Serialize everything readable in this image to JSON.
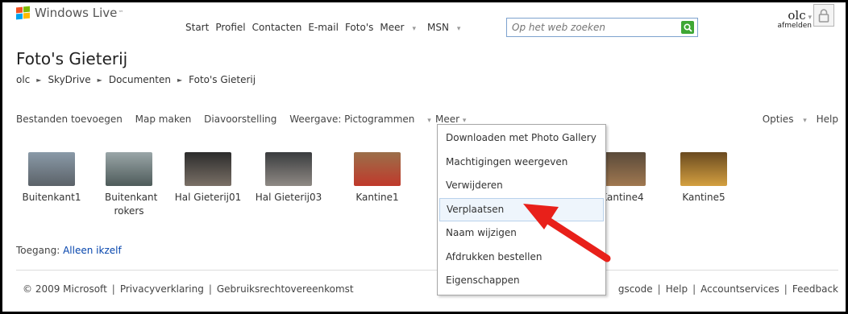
{
  "header": {
    "logo_text": "Windows Live",
    "logo_tm": "™",
    "nav": [
      {
        "label": "Start",
        "dropdown": false
      },
      {
        "label": "Profiel",
        "dropdown": false
      },
      {
        "label": "Contacten",
        "dropdown": false
      },
      {
        "label": "E-mail",
        "dropdown": false
      },
      {
        "label": "Foto's",
        "dropdown": false
      },
      {
        "label": "Meer",
        "dropdown": true
      },
      {
        "label": "MSN",
        "dropdown": true
      }
    ],
    "search_placeholder": "Op het web zoeken",
    "user_name": "olc",
    "sign_out": "afmelden"
  },
  "page": {
    "title": "Foto's Gieterij",
    "breadcrumb": [
      "olc",
      "SkyDrive",
      "Documenten",
      "Foto's Gieterij"
    ]
  },
  "toolbar": {
    "add_files": "Bestanden toevoegen",
    "new_folder": "Map maken",
    "slideshow": "Diavoorstelling",
    "view": "Weergave: Pictogrammen",
    "more": "Meer",
    "options": "Opties",
    "help": "Help"
  },
  "thumbnails": [
    {
      "label": "Buitenkant1",
      "colors": [
        "#8a9aa8",
        "#5b6268"
      ]
    },
    {
      "label": "Buitenkant rokers",
      "colors": [
        "#9aa6a8",
        "#4e5b5a"
      ]
    },
    {
      "label": "Hal Gieterij01",
      "colors": [
        "#2c2c2c",
        "#7a7066"
      ]
    },
    {
      "label": "Hal Gieterij03",
      "colors": [
        "#3a3c3e",
        "#8f8a85"
      ]
    },
    {
      "label": "Kantine1",
      "colors": [
        "#9b6f4a",
        "#c0392b"
      ]
    },
    {
      "label": "Kantine4",
      "colors": [
        "#5a4a3a",
        "#a07850"
      ]
    },
    {
      "label": "Kantine5",
      "colors": [
        "#6a4a20",
        "#d4a040"
      ]
    }
  ],
  "access": {
    "label": "Toegang:",
    "value": "Alleen ikzelf"
  },
  "footer": {
    "copyright": "© 2009 Microsoft",
    "privacy": "Privacyverklaring",
    "terms": "Gebruiksrechtovereenkomst",
    "code_partial": "gscode",
    "help": "Help",
    "account": "Accountservices",
    "feedback": "Feedback"
  },
  "menu": {
    "items": [
      "Downloaden met Photo Gallery",
      "Machtigingen weergeven",
      "Verwijderen",
      "Verplaatsen",
      "Naam wijzigen",
      "Afdrukken bestellen",
      "Eigenschappen"
    ],
    "highlighted_index": 3
  },
  "colors": {
    "arrow": "#e8201a",
    "menu_highlight": "#eef5fc",
    "link": "#0645ad",
    "search_button": "#3ea735"
  }
}
